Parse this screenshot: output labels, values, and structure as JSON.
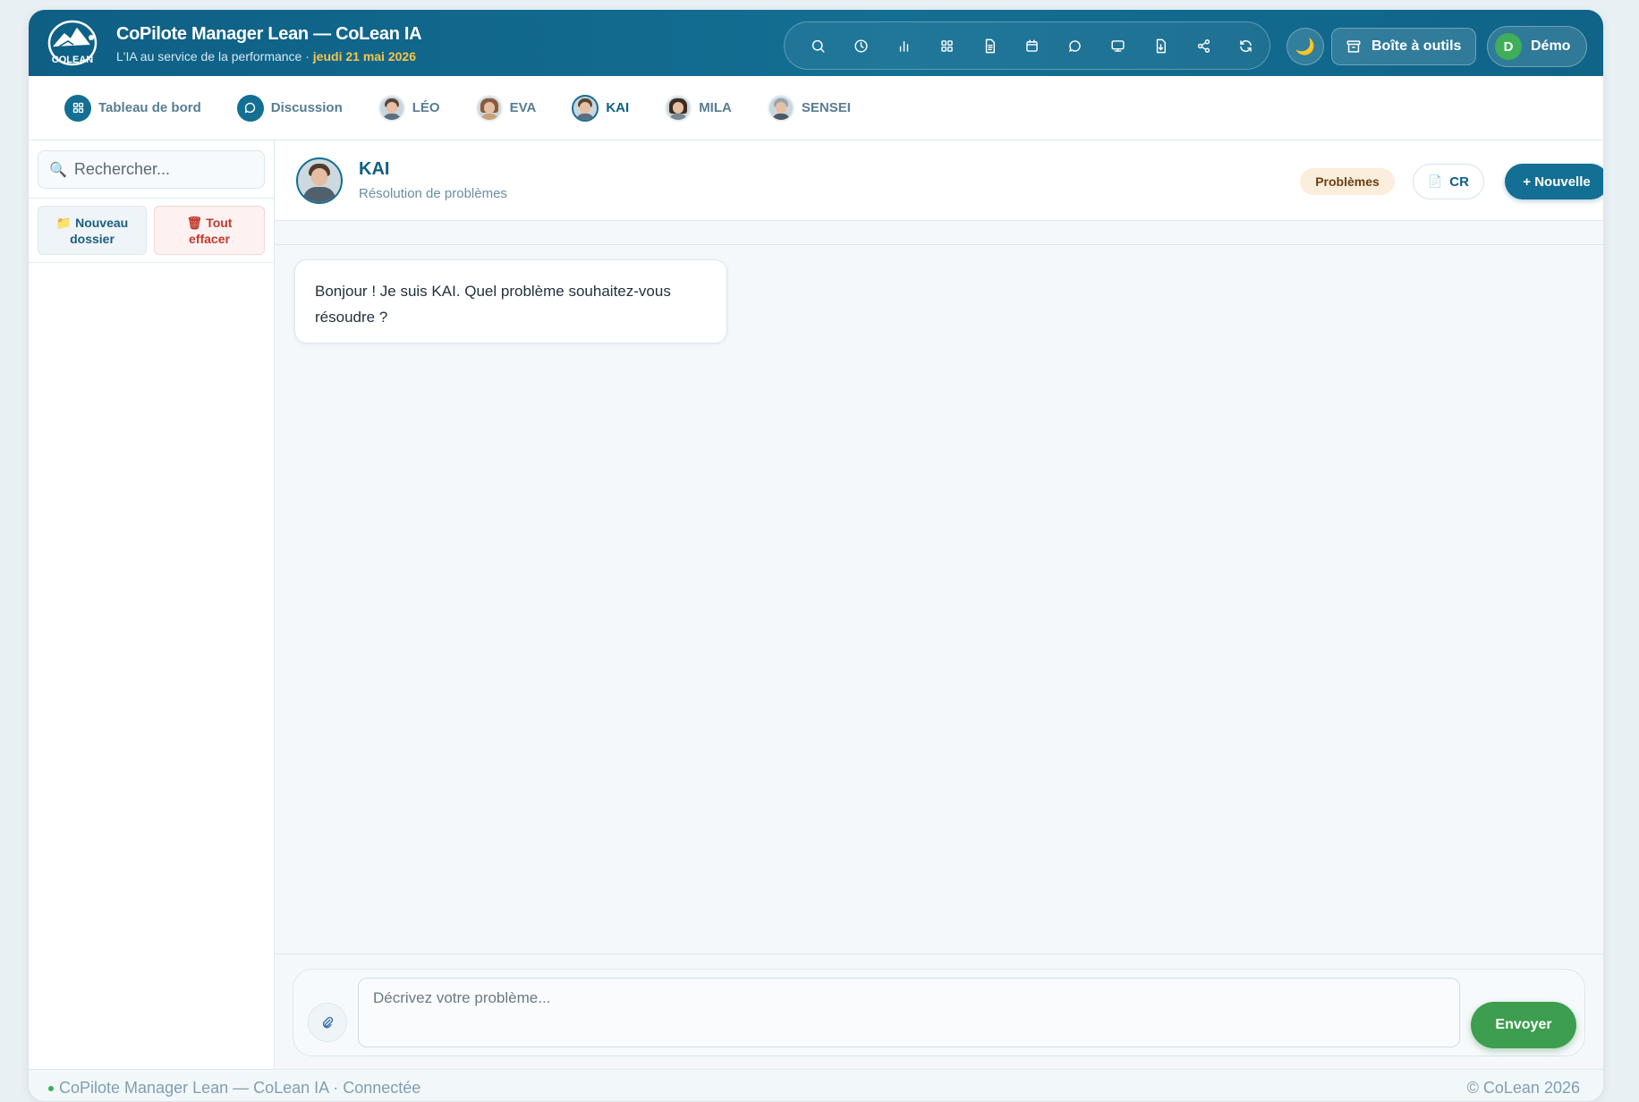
{
  "header": {
    "logo_text": "COLEAN",
    "title": "CoPilote Manager Lean — CoLean IA",
    "subtitle": "L'IA au service de la performance · ",
    "date": "jeudi 21 mai 2026",
    "tool_icons": [
      "search-icon",
      "clock-icon",
      "bar-chart-icon",
      "grid-icon",
      "document-icon",
      "calendar-icon",
      "chat-icon",
      "monitor-icon",
      "file-download-icon",
      "share-icon",
      "refresh-icon"
    ],
    "theme_icon": "🌙",
    "toolbox_label": "Boîte à outils",
    "user_initial": "D",
    "user_name": "Démo"
  },
  "nav": {
    "items": [
      {
        "label": "Tableau de bord",
        "icon": "dashboard-icon"
      },
      {
        "label": "Discussion",
        "icon": "chat-icon"
      },
      {
        "label": "LÉO",
        "icon": "avatar"
      },
      {
        "label": "EVA",
        "icon": "avatar"
      },
      {
        "label": "KAI",
        "icon": "avatar",
        "active": true
      },
      {
        "label": "MILA",
        "icon": "avatar"
      },
      {
        "label": "SENSEI",
        "icon": "avatar"
      }
    ]
  },
  "sidebar": {
    "search_placeholder": "Rechercher...",
    "search_icon": "🔍",
    "new_folder_icon": "📁",
    "new_folder_line1": "Nouveau",
    "new_folder_line2": "dossier",
    "clear_icon": "🗑",
    "clear_line1": "Tout",
    "clear_line2": "effacer"
  },
  "chat": {
    "agent_name": "KAI",
    "agent_role": "Résolution de problèmes",
    "badge": "Problèmes",
    "cr_label": "CR",
    "cr_icon": "📄",
    "new_label": "+ Nouvelle",
    "messages": [
      {
        "from": "agent",
        "text": "Bonjour ! Je suis KAI. Quel problème souhaitez-vous résoudre ?"
      }
    ],
    "input_placeholder": "Décrivez votre problème...",
    "send_label": "Envoyer"
  },
  "footer": {
    "status": "CoPilote Manager Lean — CoLean IA · Connectée",
    "copyright": "© CoLean 2026"
  },
  "colors": {
    "primary": "#136f93",
    "accent_date": "#f6c64a",
    "send": "#3c9e4e",
    "online": "#3fae58"
  }
}
